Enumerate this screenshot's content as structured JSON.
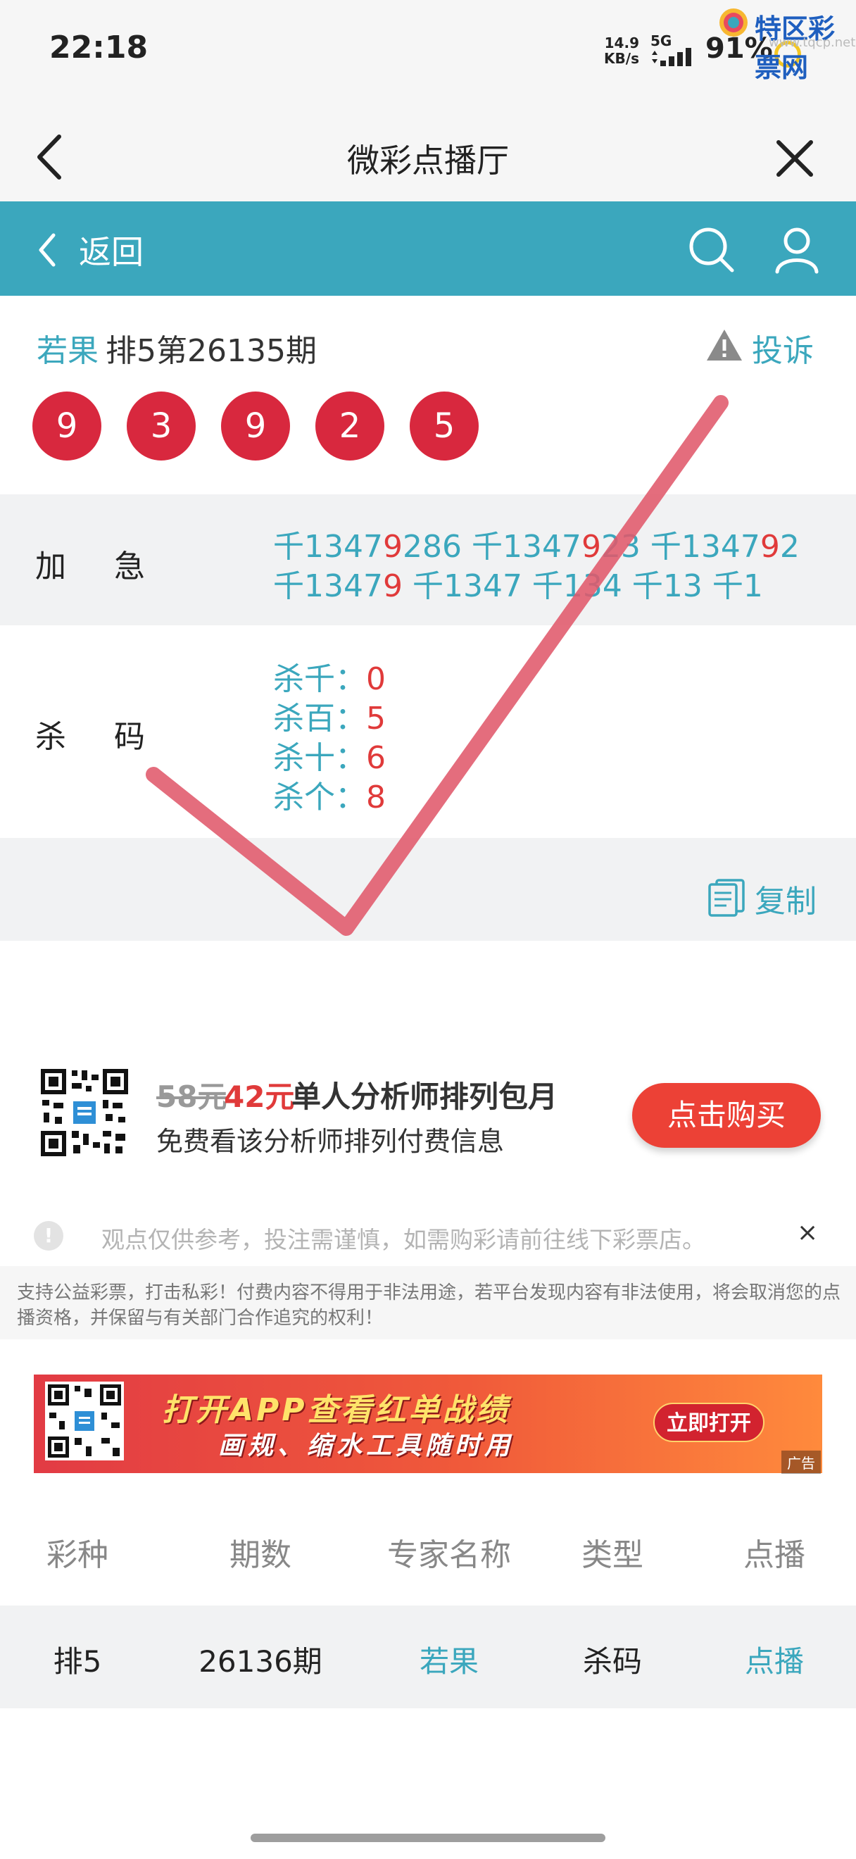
{
  "status_bar": {
    "time": "22:18",
    "net_speed_value": "14.9",
    "net_speed_unit": "KB/s",
    "network": "5G",
    "battery": "91%"
  },
  "watermark": {
    "site_name": "特区彩票网",
    "url": "www.tqcp.net"
  },
  "nav": {
    "title": "微彩点播厅"
  },
  "toolbar": {
    "back_label": "返回"
  },
  "header": {
    "expert_name": "若果",
    "issue_title": "排5第26135期",
    "complain_label": "投诉"
  },
  "balls": [
    "9",
    "3",
    "9",
    "2",
    "5"
  ],
  "jiaji": {
    "label": "加急",
    "line1": [
      {
        "pre": "千13479",
        "red": "",
        "post": "286"
      },
      {
        "pre": "千13479",
        "red": "",
        "post": "23"
      },
      {
        "pre": "千134792",
        "red": "",
        "post": ""
      }
    ],
    "line1_text_a": "千1347",
    "line1_red_a": "9",
    "line1_text_b": "286 千1347",
    "line1_red_b": "9",
    "line1_text_c": "23 千1347",
    "line1_red_c": "9",
    "line1_text_d": "2",
    "line2_text_a": "千1347",
    "line2_red_a": "9",
    "line2_text_b": " 千1347 千134 千13 千1"
  },
  "shama": {
    "label": "杀码",
    "items": [
      {
        "key": "杀千：",
        "val": "0"
      },
      {
        "key": "杀百：",
        "val": "5"
      },
      {
        "key": "杀十：",
        "val": "6"
      },
      {
        "key": "杀个：",
        "val": "8"
      }
    ]
  },
  "copy": {
    "label": "复制"
  },
  "promo": {
    "old_price": "58元",
    "new_price": "42元",
    "title": "单人分析师排列包月",
    "desc": "免费看该分析师排列付费信息",
    "buy_label": "点击购买"
  },
  "notice": {
    "icon": "!",
    "text": "观点仅供参考，投注需谨慎，如需购彩请前往线下彩票店。",
    "close": "×"
  },
  "disclaimer": "支持公益彩票，打击私彩！付费内容不得用于非法用途，若平台发现内容有非法使用，将会取消您的点播资格，并保留与有关部门合作追究的权利！",
  "banner": {
    "title": "打开APP查看红单战绩",
    "subtitle": "画规、缩水工具随时用",
    "button": "立即打开",
    "ad_tag": "广告"
  },
  "table": {
    "headers": [
      "彩种",
      "期数",
      "专家名称",
      "类型",
      "点播"
    ],
    "rows": [
      {
        "lottery": "排5",
        "issue": "26136期",
        "expert": "若果",
        "type": "杀码",
        "action": "点播"
      }
    ]
  },
  "colors": {
    "teal": "#3ba7bd",
    "ball_red": "#d8283e",
    "accent_red": "#e03a3a",
    "check": "#e0596b"
  }
}
